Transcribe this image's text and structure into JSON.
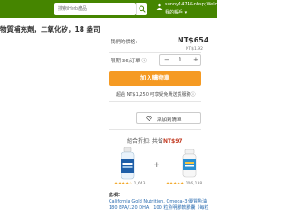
{
  "header": {
    "search_placeholder": "搜索iHerb產品",
    "user_name": "sunny1474&nbsp;Welco@yahoo...",
    "user_account": "我的帳戶 ▾"
  },
  "product": {
    "title": "物質補充劑，二氧化矽，18 盎司"
  },
  "purchase": {
    "price_label": "我們的價格:",
    "price": "NT$654",
    "unit_price": "NT$1.92",
    "deadline": "限期 36/订單 ⓘ",
    "quantity": "1",
    "minus": "−",
    "plus": "+",
    "add_to_cart": "加入購物車",
    "shipping": "超過 NT$1,250 可享受免費送貨服務ⓘ",
    "wishlist": "添加到清單"
  },
  "bundle": {
    "title_prefix": "組合折扣: 共省",
    "title_price": "NT$97",
    "item1_stars": "★★★★☆",
    "item1_count": "1,643",
    "item2_stars": "★★★★★",
    "item2_count": "106,138",
    "this_item": "此項:",
    "link1": "California Gold Nutrition, Omega-3 優質魚油，",
    "link2": "180 EPA/120 DHA，100 粒魚明膠軟膠囊（每粒"
  },
  "colors": {
    "brand_green": "#458500",
    "cart_orange": "#f59a23",
    "discount_red": "#c23b22",
    "link_blue": "#2b6cb0"
  }
}
